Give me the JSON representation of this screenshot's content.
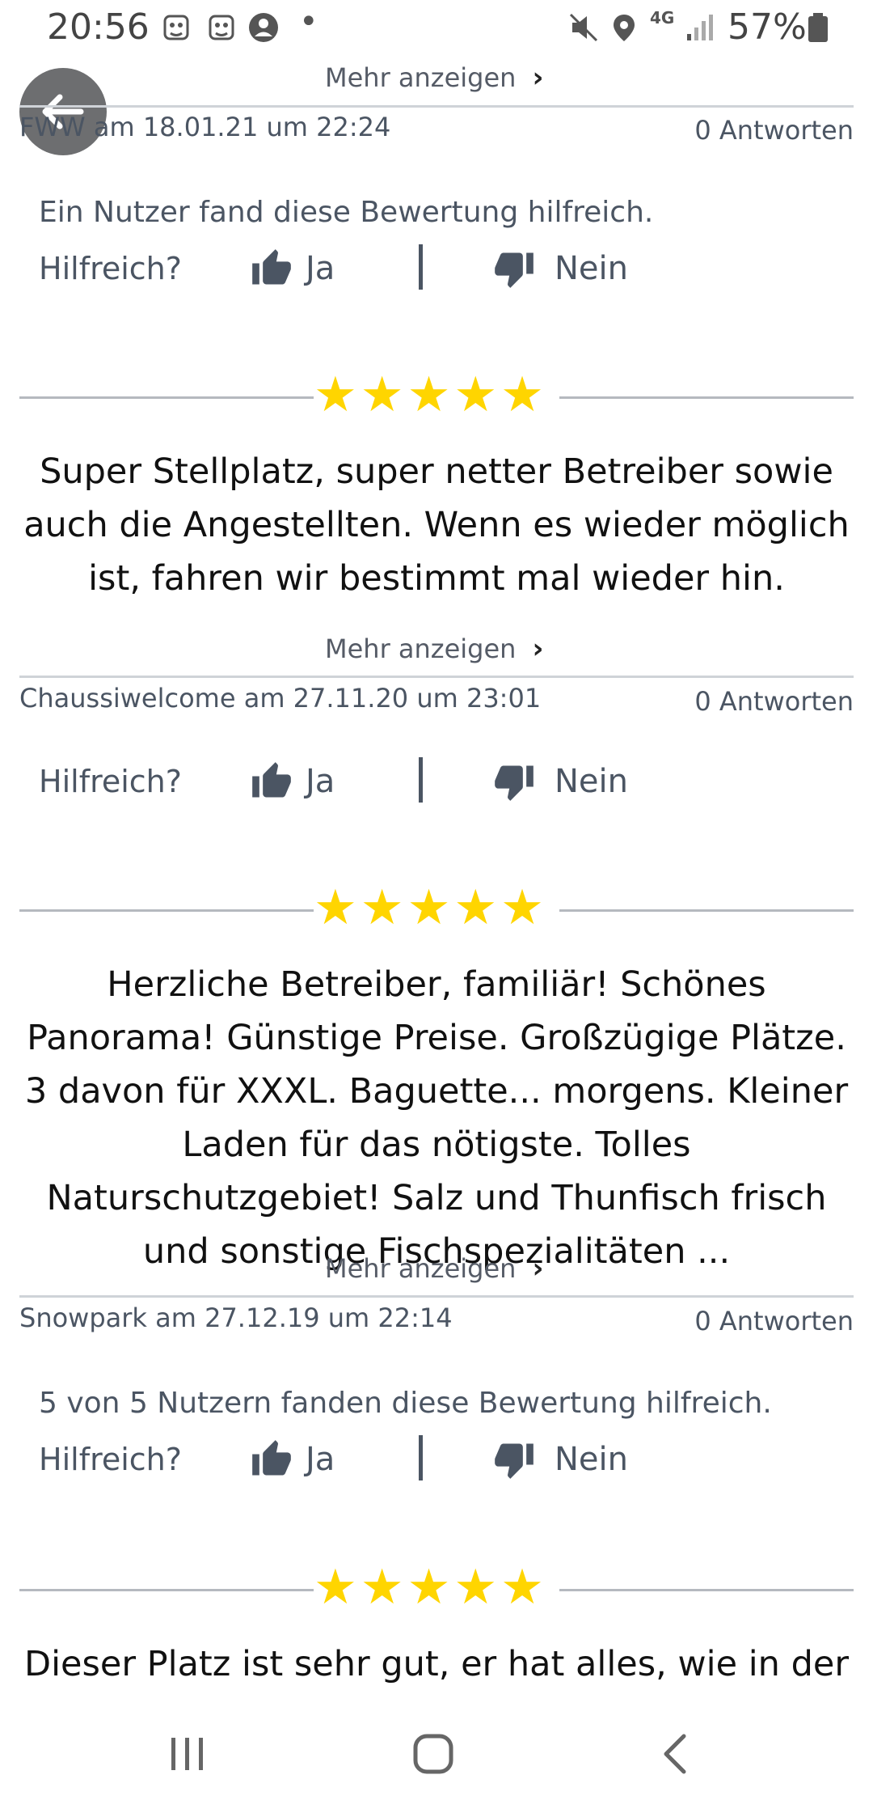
{
  "status_bar": {
    "time": "20:56",
    "battery": "57%",
    "network": "4G",
    "dot": "•",
    "icons": [
      "face-notification-icon",
      "face-notification-icon",
      "account-icon",
      "mute-icon",
      "location-icon",
      "network-4g-icon",
      "signal-icon",
      "battery-icon"
    ]
  },
  "reviews": [
    {
      "more_label": "Mehr anzeigen",
      "author_line": "FWW am 18.01.21 um 22:24",
      "answers": "0 Antworten",
      "helpful_count_text": "Ein Nutzer fand diese Bewertung hilfreich.",
      "helpful_q": "Hilfreich?",
      "yes": "Ja",
      "no": "Nein"
    },
    {
      "rating": 5,
      "text": "Super Stellplatz,  super netter Betreiber sowie auch die Angestellten. Wenn es wieder möglich ist, fahren wir bestimmt mal wieder hin.",
      "more_label": "Mehr anzeigen",
      "author_line": "Chaussiwelcome am 27.11.20 um 23:01",
      "answers": "0 Antworten",
      "helpful_q": "Hilfreich?",
      "yes": "Ja",
      "no": "Nein"
    },
    {
      "rating": 5,
      "text": "Herzliche Betreiber, familiär! Schönes Panorama! Günstige Preise. Großzügige Plätze. 3 davon für XXXL. Baguette... morgens. Kleiner Laden für das nötigste. Tolles Naturschutzgebiet! Salz und Thunfisch frisch und sonstige Fischspezialitäten ...",
      "more_label": "Mehr anzeigen",
      "author_line": "Snowpark am 27.12.19 um 22:14",
      "answers": "0 Antworten",
      "helpful_count_text": "5 von 5 Nutzern fanden diese Bewertung hilfreich.",
      "helpful_q": "Hilfreich?",
      "yes": "Ja",
      "no": "Nein"
    },
    {
      "rating": 5,
      "text": "Dieser Platz ist sehr gut, er hat alles, wie in der"
    }
  ],
  "stars_glyph": "★★★★★",
  "colors": {
    "star": "#ffd500",
    "text_muted": "#4b5563",
    "back_button": "#6d6e70"
  }
}
